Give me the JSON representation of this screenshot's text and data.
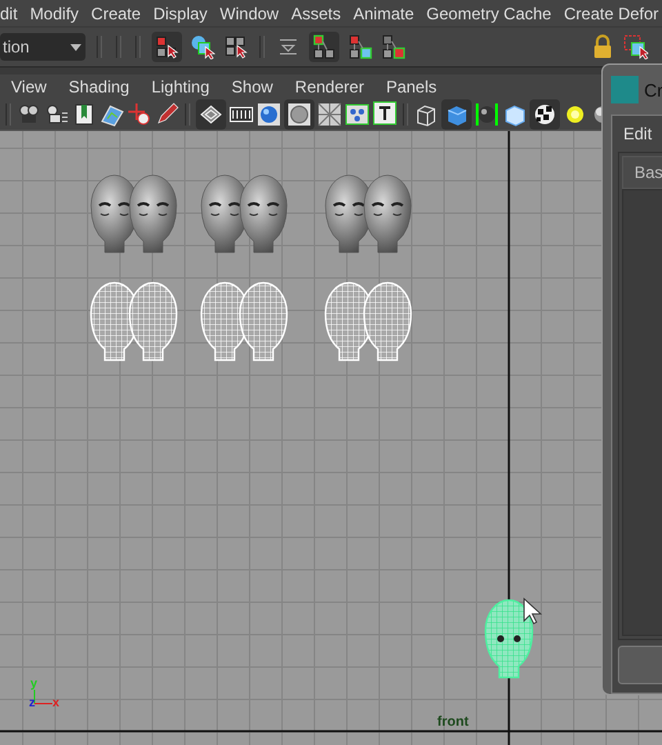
{
  "menu_bar": [
    "dit",
    "Modify",
    "Create",
    "Display",
    "Window",
    "Assets",
    "Animate",
    "Geometry Cache",
    "Create Defor"
  ],
  "toolbar": {
    "mode_dropdown": "tion"
  },
  "panel_menu": [
    "View",
    "Shading",
    "Lighting",
    "Show",
    "Renderer",
    "Panels"
  ],
  "viewport": {
    "camera_label": "front",
    "axis_labels": [
      "y",
      "z",
      "x"
    ],
    "models": [
      {
        "kind": "shaded"
      },
      {
        "kind": "shaded"
      },
      {
        "kind": "shaded"
      },
      {
        "kind": "wireframe"
      },
      {
        "kind": "wireframe"
      },
      {
        "kind": "wireframe"
      },
      {
        "kind": "selected"
      }
    ]
  },
  "dialog": {
    "title": "Cr",
    "menu": [
      "Edit"
    ],
    "tab": "Bas"
  }
}
